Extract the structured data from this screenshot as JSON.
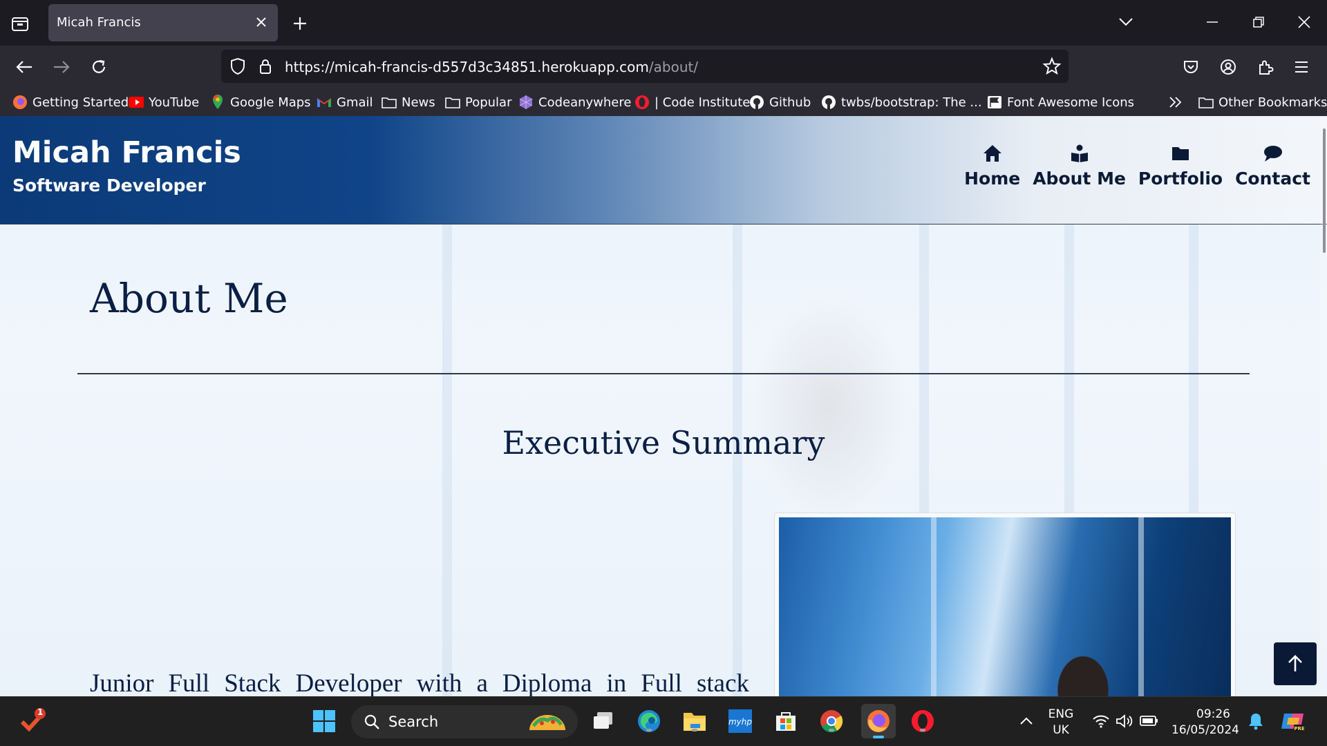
{
  "browser": {
    "tab_title": "Micah Francis",
    "url_main": "https://micah-francis-d557d3c34851.herokuapp.com",
    "url_path": "/about/",
    "bookmarks": [
      {
        "label": "Getting Started",
        "icon": "firefox-icon"
      },
      {
        "label": "YouTube",
        "icon": "youtube-icon"
      },
      {
        "label": "Google Maps",
        "icon": "maps-pin-icon"
      },
      {
        "label": "Gmail",
        "icon": "gmail-icon"
      },
      {
        "label": "News",
        "icon": "folder-icon"
      },
      {
        "label": "Popular",
        "icon": "folder-icon"
      },
      {
        "label": "Codeanywhere",
        "icon": "codeanywhere-icon"
      },
      {
        "label": "| Code Institute",
        "icon": "opera-icon"
      },
      {
        "label": "Github",
        "icon": "github-icon"
      },
      {
        "label": "twbs/bootstrap: The ...",
        "icon": "github-icon"
      },
      {
        "label": "Font Awesome Icons",
        "icon": "flag-icon"
      }
    ],
    "other_bookmarks": "Other Bookmarks"
  },
  "site": {
    "brand_name": "Micah Francis",
    "brand_sub": "Software Developer",
    "nav": [
      {
        "label": "Home",
        "icon": "home-icon"
      },
      {
        "label": "About Me",
        "icon": "about-icon"
      },
      {
        "label": "Portfolio",
        "icon": "folder-icon"
      },
      {
        "label": "Contact",
        "icon": "chat-icon"
      }
    ]
  },
  "page": {
    "title": "About Me",
    "section_title": "Executive Summary",
    "summary_first_line": "Junior Full Stack Developer with a Diploma in Full stack"
  },
  "taskbar": {
    "search_label": "Search",
    "notification_count": "1",
    "lang_top": "ENG",
    "lang_bottom": "UK",
    "time": "09:26",
    "date": "16/05/2024"
  },
  "colors": {
    "header_dark": "#0c3a78",
    "nav_text": "#0b1a36",
    "heading": "#0a1f44",
    "back_to_top": "#0a1a36"
  }
}
